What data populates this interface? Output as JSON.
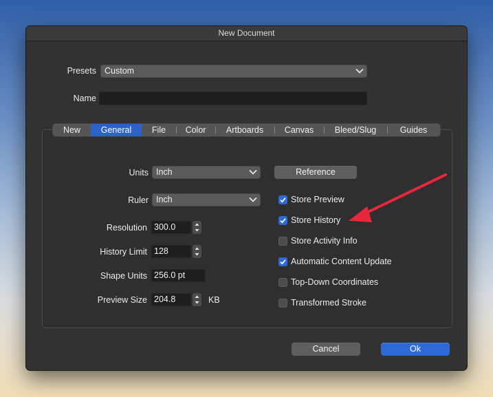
{
  "window": {
    "title": "New Document"
  },
  "presets": {
    "label": "Presets",
    "value": "Custom"
  },
  "name": {
    "label": "Name",
    "value": ""
  },
  "tabs": [
    {
      "label": "New",
      "active": false
    },
    {
      "label": "General",
      "active": true
    },
    {
      "label": "File",
      "active": false
    },
    {
      "label": "Color",
      "active": false
    },
    {
      "label": "Artboards",
      "active": false
    },
    {
      "label": "Canvas",
      "active": false
    },
    {
      "label": "Bleed/Slug",
      "active": false
    },
    {
      "label": "Guides",
      "active": false
    }
  ],
  "general": {
    "units": {
      "label": "Units",
      "value": "Inch"
    },
    "ruler": {
      "label": "Ruler",
      "value": "Inch"
    },
    "resolution": {
      "label": "Resolution",
      "value": "300.0"
    },
    "history_limit": {
      "label": "History Limit",
      "value": "128"
    },
    "shape_units": {
      "label": "Shape Units",
      "value": "256.0 pt"
    },
    "preview_size": {
      "label": "Preview Size",
      "value": "204.8",
      "unit": "KB"
    },
    "reference_button": "Reference",
    "checkboxes": [
      {
        "label": "Store Preview",
        "checked": true
      },
      {
        "label": "Store History",
        "checked": true
      },
      {
        "label": "Store Activity Info",
        "checked": false
      },
      {
        "label": "Automatic Content Update",
        "checked": true
      },
      {
        "label": "Top-Down Coordinates",
        "checked": false
      },
      {
        "label": "Transformed Stroke",
        "checked": false
      }
    ]
  },
  "footer": {
    "cancel_label": "Cancel",
    "ok_label": "Ok"
  },
  "colors": {
    "accent": "#2e6ad6",
    "annotation_arrow": "#e8273d"
  }
}
